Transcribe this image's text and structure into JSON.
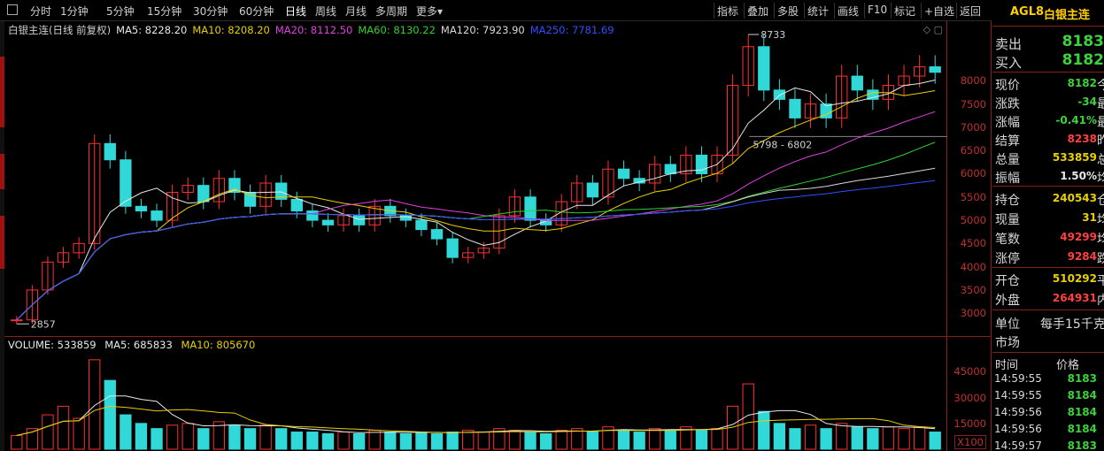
{
  "toolbar": {
    "periods": [
      "分时",
      "1分钟",
      "5分钟",
      "15分钟",
      "30分钟",
      "60分钟",
      "日线",
      "周线",
      "月线",
      "多周期",
      "更多▾"
    ],
    "active_period": "日线",
    "tools": [
      "指标",
      "叠加",
      "多股",
      "统计",
      "画线",
      "F10",
      "标记",
      "+自选",
      "返回"
    ]
  },
  "price_pane": {
    "title": "白银主连(日线 前复权)",
    "ma": [
      {
        "label": "MA5: 8228.20",
        "color": "#e8e8e8"
      },
      {
        "label": "MA10: 8208.20",
        "color": "#e8d000"
      },
      {
        "label": "MA20: 8112.50",
        "color": "#e040e0"
      },
      {
        "label": "MA60: 8130.22",
        "color": "#30d030"
      },
      {
        "label": "MA120: 7923.90",
        "color": "#d8d8d8"
      },
      {
        "label": "MA250: 7781.69",
        "color": "#3050ff"
      }
    ],
    "high_label": "8733",
    "low_label": "2857",
    "range_label": "5798 - 6802",
    "corner_icons": [
      "◇",
      "▢"
    ]
  },
  "volume_pane": {
    "title": "VOLUME: 533859",
    "ma5": "MA5: 685833",
    "ma10": "MA10: 805670",
    "unit": "X100"
  },
  "price_axis": [
    "8000",
    "7500",
    "7000",
    "6500",
    "6000",
    "5500",
    "5000",
    "4500",
    "4000",
    "3500",
    "3000"
  ],
  "volume_axis": [
    "45000",
    "30000",
    "15000"
  ],
  "quote": {
    "code": "AGL8",
    "name": "白银主连",
    "sell": {
      "label": "卖出",
      "value": "8183"
    },
    "buy": {
      "label": "买入",
      "value": "8182"
    },
    "rows1": [
      {
        "label": "现价",
        "value": "8182",
        "color": "green",
        "tail": "今"
      },
      {
        "label": "涨跌",
        "value": "-34",
        "color": "green",
        "tail": "最"
      },
      {
        "label": "涨幅",
        "value": "-0.41%",
        "color": "green",
        "tail": "最"
      },
      {
        "label": "结算",
        "value": "8238",
        "color": "red",
        "tail": "昨"
      },
      {
        "label": "总量",
        "value": "533859",
        "color": "yellow",
        "tail": "总"
      },
      {
        "label": "振幅",
        "value": "1.50%",
        "color": "white",
        "tail": "均"
      }
    ],
    "rows2": [
      {
        "label": "持仓",
        "value": "240543",
        "color": "yellow",
        "tail": "仓"
      },
      {
        "label": "现量",
        "value": "31",
        "color": "yellow",
        "tail": "均"
      },
      {
        "label": "笔数",
        "value": "49299",
        "color": "red",
        "tail": "均"
      },
      {
        "label": "涨停",
        "value": "9284",
        "color": "red",
        "tail": "跌"
      }
    ],
    "rows3": [
      {
        "label": "开仓",
        "value": "510292",
        "color": "yellow",
        "tail": "平"
      },
      {
        "label": "外盘",
        "value": "264931",
        "color": "red",
        "tail": "内"
      }
    ],
    "unit_label": "单位",
    "unit_value": "每手15千克",
    "market_label": "市场",
    "ticks_header": {
      "time": "时间",
      "price": "价格"
    },
    "ticks": [
      {
        "time": "14:59:55",
        "price": "8183"
      },
      {
        "time": "14:59:55",
        "price": "8184"
      },
      {
        "time": "14:59:56",
        "price": "8184"
      },
      {
        "time": "14:59:56",
        "price": "8184"
      },
      {
        "time": "14:59:57",
        "price": "8183"
      }
    ]
  },
  "chart_data": {
    "type": "candlestick",
    "ylim": [
      2700,
      8900
    ],
    "volume_ylim": [
      0,
      55000
    ],
    "closes": [
      2857,
      3500,
      4100,
      4300,
      4500,
      6650,
      6300,
      5300,
      5200,
      5000,
      5600,
      5750,
      5400,
      5900,
      5600,
      5300,
      5800,
      5450,
      5200,
      5000,
      4900,
      5100,
      4900,
      5300,
      5100,
      5000,
      4800,
      4600,
      4200,
      4300,
      4400,
      5100,
      5500,
      5000,
      4900,
      5400,
      5800,
      5500,
      6100,
      5900,
      5800,
      6200,
      6000,
      6400,
      6000,
      6400,
      7900,
      8733,
      7800,
      7600,
      7200,
      7500,
      7200,
      8100,
      7800,
      7600,
      7900,
      8100,
      8300,
      8182
    ],
    "volume": [
      8000,
      12000,
      20000,
      25000,
      18000,
      52000,
      40000,
      20000,
      15000,
      12000,
      14000,
      15000,
      12000,
      16000,
      14000,
      12000,
      14000,
      12000,
      10000,
      10000,
      9000,
      10000,
      9000,
      11000,
      10000,
      9000,
      10000,
      9000,
      10000,
      11000,
      10000,
      12000,
      11000,
      10000,
      9000,
      11000,
      12000,
      10000,
      13000,
      11000,
      10000,
      12000,
      11000,
      13000,
      11000,
      12000,
      25000,
      38000,
      22000,
      15000,
      12000,
      14000,
      12000,
      15000,
      13000,
      12000,
      13000,
      12000,
      13000,
      10000
    ]
  }
}
